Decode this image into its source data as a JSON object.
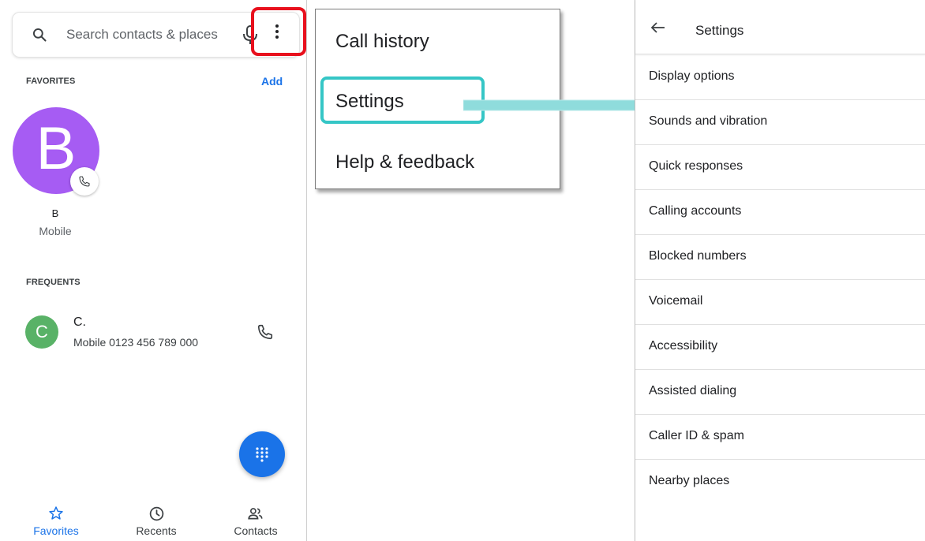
{
  "dialer": {
    "search_placeholder": "Search contacts & places",
    "favorites_header": "FAVORITES",
    "add_label": "Add",
    "favorite": {
      "initial": "B",
      "name": "B",
      "type": "Mobile"
    },
    "frequents_header": "FREQUENTS",
    "frequent": {
      "initial": "C",
      "name": "C.",
      "number": "Mobile 0123  456 789  000"
    },
    "nav": [
      {
        "label": "Favorites",
        "icon": "star-icon",
        "active": true
      },
      {
        "label": "Recents",
        "icon": "clock-icon",
        "active": false
      },
      {
        "label": "Contacts",
        "icon": "people-icon",
        "active": false
      }
    ],
    "colors": {
      "accent": "#1a73e8",
      "avatar_b": "#a65cf3",
      "avatar_c": "#59b267",
      "highlight_red": "#e8101d"
    }
  },
  "menu": {
    "items": [
      "Call history",
      "Settings",
      "Help & feedback"
    ],
    "highlight_color": "#35c6c6"
  },
  "settings": {
    "title": "Settings",
    "items": [
      "Display options",
      "Sounds and vibration",
      "Quick responses",
      "Calling accounts",
      "Blocked numbers",
      "Voicemail",
      "Accessibility",
      "Assisted dialing",
      "Caller ID & spam",
      "Nearby places"
    ]
  }
}
